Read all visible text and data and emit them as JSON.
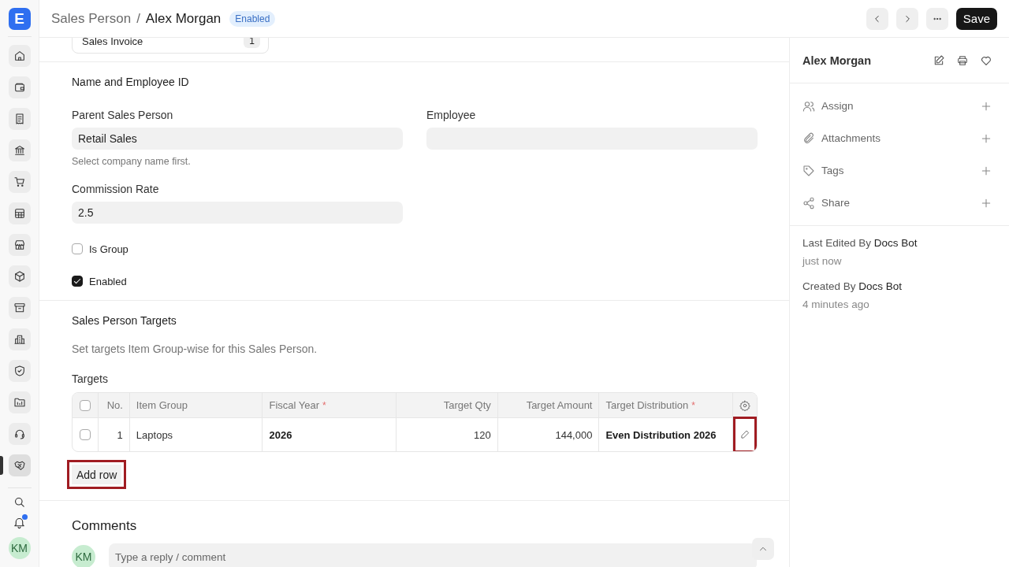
{
  "app": {
    "logo": "E"
  },
  "sidebar": {
    "items": [
      {
        "selected": false
      },
      {
        "selected": false
      },
      {
        "selected": false
      },
      {
        "selected": false
      },
      {
        "selected": false
      },
      {
        "selected": false
      },
      {
        "selected": false
      },
      {
        "selected": false
      },
      {
        "selected": false
      },
      {
        "selected": false
      },
      {
        "selected": false
      },
      {
        "selected": false
      },
      {
        "selected": false
      },
      {
        "selected": true
      }
    ],
    "notifications_unread": true,
    "avatar": "KM"
  },
  "header": {
    "breadcrumb": "Sales Person",
    "separator": "/",
    "title": "Alex Morgan",
    "status": "Enabled",
    "save": "Save"
  },
  "connections": [
    {
      "label": "Sales Invoice",
      "count": "1"
    }
  ],
  "name_section": {
    "title": "Name and Employee ID",
    "fields": [
      {
        "label": "Parent Sales Person",
        "value": "Retail Sales",
        "description": "Select company name first."
      },
      {
        "label": "Employee"
      },
      {
        "label": "Commission Rate",
        "value": "2.5"
      }
    ],
    "checkboxes": [
      {
        "label": "Is Group",
        "checked": false
      },
      {
        "label": "Enabled",
        "checked": true
      }
    ]
  },
  "targets_section": {
    "title": "Sales Person Targets",
    "description": "Set targets Item Group-wise for this Sales Person.",
    "table_label": "Targets",
    "header_checked": false,
    "columns": [
      {
        "label": "No."
      },
      {
        "label": "Item Group"
      },
      {
        "label": "Fiscal Year",
        "required_mark": "*"
      },
      {
        "label": "Target Qty"
      },
      {
        "label": "Target Amount"
      },
      {
        "label": "Target Distribution",
        "required_mark": "*"
      }
    ],
    "rows": [
      {
        "selected": false,
        "edit_highlighted": true,
        "cells": [
          {
            "text": "1",
            "bold": false
          },
          {
            "text": "Laptops",
            "bold": false
          },
          {
            "text": "2026",
            "bold": true
          },
          {
            "text": "120",
            "bold": false
          },
          {
            "text": "144,000",
            "bold": false
          },
          {
            "text": "Even Distribution 2026",
            "bold": true
          }
        ]
      }
    ],
    "add_row": {
      "label": "Add row",
      "highlighted": true
    }
  },
  "comments": {
    "title": "Comments",
    "avatar": "KM",
    "placeholder": "Type a reply / comment"
  },
  "side_panel": {
    "title": "Alex Morgan",
    "actions": [
      {
        "label": "Assign"
      },
      {
        "label": "Attachments"
      },
      {
        "label": "Tags"
      },
      {
        "label": "Share"
      }
    ],
    "meta": [
      {
        "prefix": "Last Edited By",
        "user": "Docs Bot",
        "time": "just now"
      },
      {
        "prefix": "Created By",
        "user": "Docs Bot",
        "time": "4 minutes ago"
      }
    ]
  }
}
